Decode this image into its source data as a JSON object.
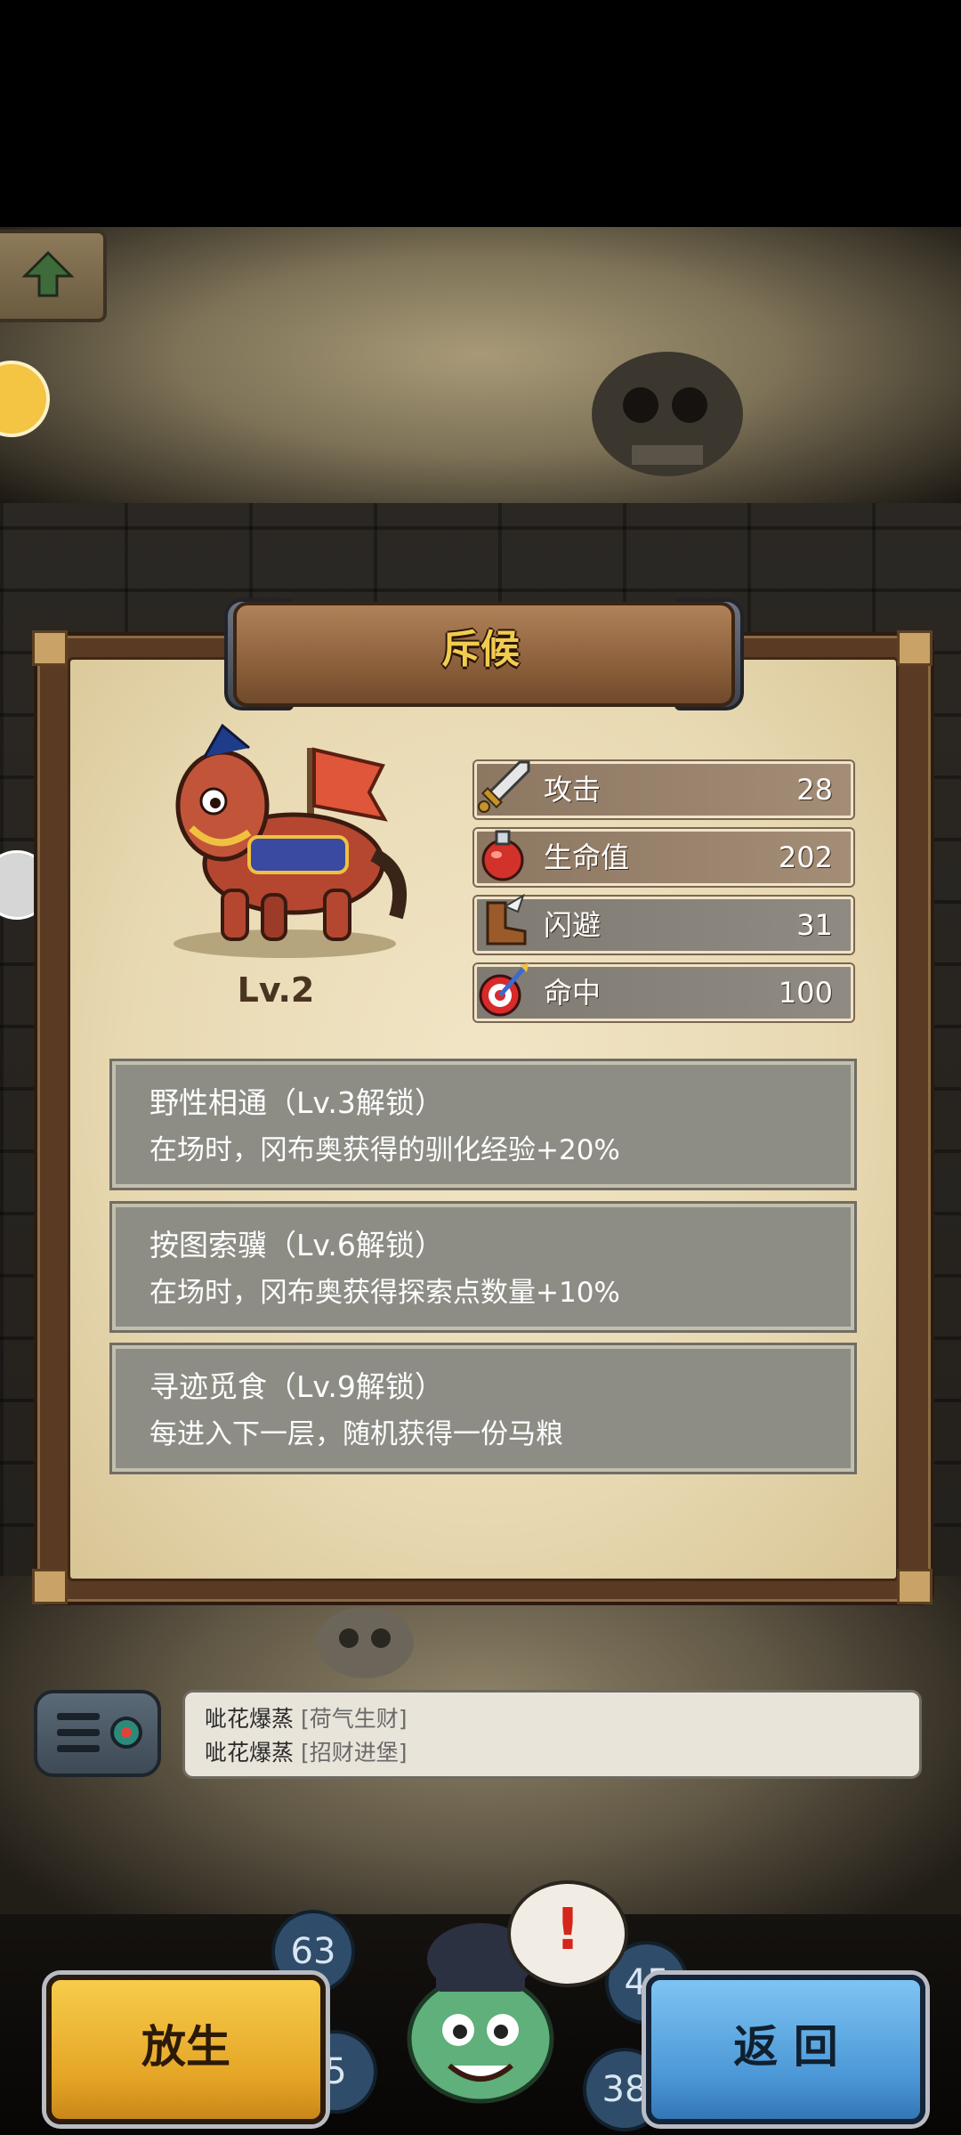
{
  "title": "斥候",
  "pet": {
    "level": "Lv.2"
  },
  "stats": [
    {
      "label": "攻击",
      "value": "28",
      "icon": "sword-icon"
    },
    {
      "label": "生命值",
      "value": "202",
      "icon": "potion-icon"
    },
    {
      "label": "闪避",
      "value": "31",
      "icon": "winged-boot-icon"
    },
    {
      "label": "命中",
      "value": "100",
      "icon": "target-icon"
    }
  ],
  "skills": [
    {
      "title": "野性相通（Lv.3解锁）",
      "desc": "在场时，冈布奥获得的驯化经验+20%"
    },
    {
      "title": "按图索骥（Lv.6解锁）",
      "desc": "在场时，冈布奥获得探索点数量+10%"
    },
    {
      "title": "寻迹觅食（Lv.9解锁）",
      "desc": "每进入下一层，随机获得一份马粮"
    }
  ],
  "chat": [
    {
      "name": "呲花爆蒸",
      "tag": "[荷气生财]"
    },
    {
      "name": "呲花爆蒸",
      "tag": "[招财进堡]"
    }
  ],
  "buttons": {
    "release": "放生",
    "back": "返 回"
  },
  "bottom_badges": {
    "left_top": "63",
    "right_top": "45",
    "left_bottom": "5",
    "right_bottom": "38"
  },
  "alert_symbol": "!"
}
